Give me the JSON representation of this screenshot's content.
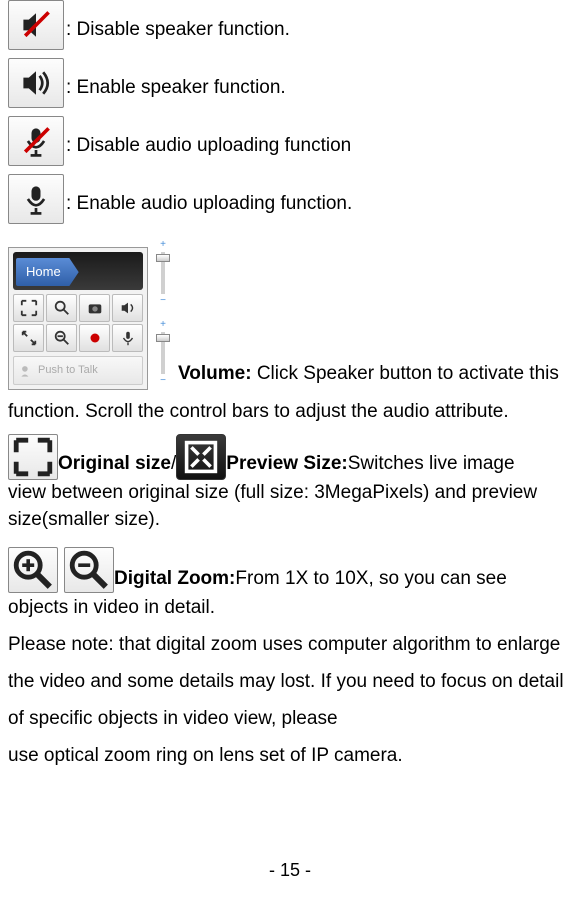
{
  "icons": {
    "speaker_disable": ":  Disable speaker function.",
    "speaker_enable": ":  Enable speaker function.",
    "mic_disable": ":  Disable audio uploading function",
    "mic_enable": ":  Enable audio uploading function."
  },
  "panel": {
    "home": "Home",
    "ptt": "Push to Talk"
  },
  "volume": {
    "label": "Volume:",
    "text1": " Click Speaker button to activate this",
    "text2": "function. Scroll the control bars to adjust the audio attribute."
  },
  "size": {
    "orig_label": " Original size",
    "slash": "/",
    "prev_label": " Preview Size:",
    "text1": " Switches live image",
    "text2": "view between original size (full size: 3MegaPixels) and preview size(smaller size)."
  },
  "zoom": {
    "label": " Digital Zoom:",
    "text1": " From 1X to 10X, so you can see",
    "text2": "objects in video in detail."
  },
  "note": "Please note: that digital zoom uses computer algorithm to enlarge the video and some details may lost.      If you need to focus on detail of specific objects in video view, please",
  "note2": "use optical zoom ring on lens set of IP camera.",
  "page": "- 15 -"
}
